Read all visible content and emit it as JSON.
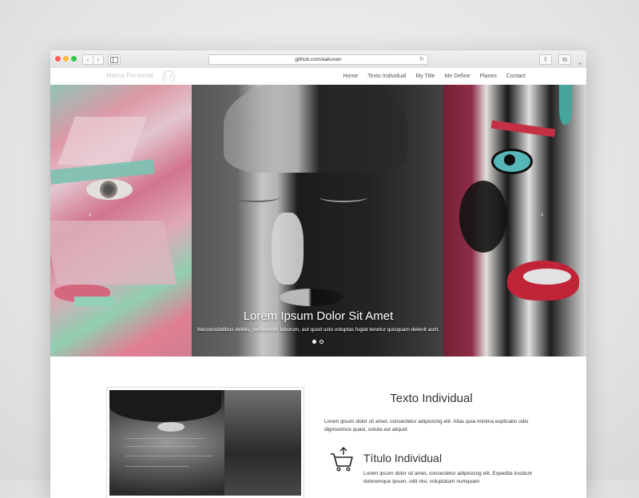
{
  "browser": {
    "url": "github.com/aakuvan",
    "reload_glyph": "↻",
    "back_glyph": "‹",
    "forward_glyph": "›",
    "share_glyph": "⇪",
    "tabs_glyph": "⧉",
    "new_tab_glyph": "+"
  },
  "site": {
    "brand": "Marca Personal",
    "logo_icon": "face-outline-icon",
    "menu": [
      "Home",
      "Texto Individual",
      "My Title",
      "Me Define",
      "Planes",
      "Contact"
    ]
  },
  "hero": {
    "title": "Lorem Ipsum Dolor Sit Amet",
    "subtitle": "Neccessitatibus debilis, perferendis laborum, aut quod usto voluptas fugiat tenetur quisquam delenit aunt.",
    "prev_glyph": "‹",
    "next_glyph": "›",
    "slide_count": 2,
    "active_slide": 1
  },
  "section": {
    "title": "Texto Individual",
    "text": "Lorem ipsum dolor sit amet, consectetur adipisicing elit. Alias quia minima explicabo odio dignissimos quasi, soluta aut aliquid",
    "item": {
      "icon": "shopping-cart-icon",
      "title": "Título Individual",
      "text": "Lorem ipsum dolor sit amet, consectetur adipisicing elit. Expedita incidunt doloremque ipsum, odit nisi, voluptatum numquam"
    }
  },
  "colors": {
    "traffic_red": "#fc605c",
    "traffic_yellow": "#fdbc40",
    "traffic_green": "#34c84a",
    "text_dark": "#333333",
    "brand_text": "#c9c9c9"
  }
}
